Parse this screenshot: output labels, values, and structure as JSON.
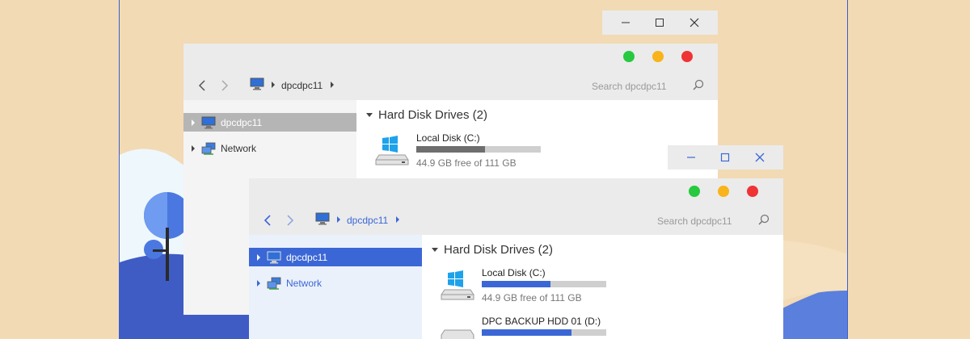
{
  "colors": {
    "background": "#f2dab5",
    "accent_blue": "#3b67d6",
    "gray_selected": "#b5b5b5",
    "traffic_green": "#27c93f",
    "traffic_yellow": "#f9b31b",
    "traffic_red": "#ee3434"
  },
  "back_window": {
    "breadcrumb": {
      "computer": "dpcdpc11"
    },
    "search": {
      "placeholder": "Search dpcdpc11"
    },
    "sidebar": {
      "items": [
        {
          "label": "dpcdpc11",
          "icon": "computer-icon",
          "selected": true
        },
        {
          "label": "Network",
          "icon": "network-icon",
          "selected": false
        }
      ]
    },
    "section": {
      "title": "Hard Disk Drives (2)"
    },
    "drives": [
      {
        "name": "Local Disk (C:)",
        "free": "44.9 GB free of 111 GB",
        "used_fraction": 0.55,
        "icon": "windows-drive-icon"
      }
    ]
  },
  "front_window": {
    "breadcrumb": {
      "computer": "dpcdpc11"
    },
    "search": {
      "placeholder": "Search dpcdpc11"
    },
    "sidebar": {
      "items": [
        {
          "label": "dpcdpc11",
          "icon": "computer-icon",
          "selected": true
        },
        {
          "label": "Network",
          "icon": "network-icon",
          "selected": false
        }
      ]
    },
    "section": {
      "title": "Hard Disk Drives (2)"
    },
    "drives": [
      {
        "name": "Local Disk (C:)",
        "free": "44.9 GB free of 111 GB",
        "used_fraction": 0.55,
        "icon": "windows-drive-icon"
      },
      {
        "name": "DPC BACKUP HDD 01 (D:)",
        "used_fraction": 0.72,
        "icon": "drive-icon"
      }
    ]
  }
}
